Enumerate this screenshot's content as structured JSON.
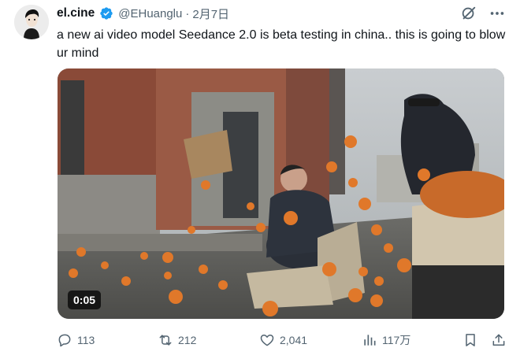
{
  "author": {
    "display_name": "el.cine",
    "handle": "@EHuanglu",
    "separator": "·",
    "date": "2月7日",
    "verified_icon": "verified-badge-icon",
    "verified_color": "#1d9bf0"
  },
  "tweet": {
    "text": "a new ai video model Seedance 2.0 is beta testing in china.. this is going to blow ur mind"
  },
  "media": {
    "type": "video",
    "duration": "0:05"
  },
  "top_actions": [
    "grok-icon",
    "more-icon"
  ],
  "metrics": {
    "replies": "113",
    "reposts": "212",
    "likes": "2,041",
    "views": "117万"
  },
  "colors": {
    "text": "#0f1419",
    "secondary": "#536471",
    "accent": "#1d9bf0"
  }
}
